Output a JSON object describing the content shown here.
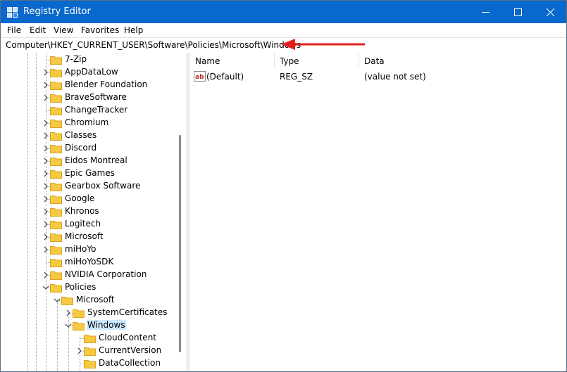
{
  "window": {
    "title": "Registry Editor"
  },
  "titlebar_buttons": {
    "minimize": "—",
    "maximize": "☐",
    "close": "✕"
  },
  "menu": [
    "File",
    "Edit",
    "View",
    "Favorites",
    "Help"
  ],
  "address": "Computer\\HKEY_CURRENT_USER\\Software\\Policies\\Microsoft\\Windows",
  "tree": [
    {
      "label": "7-Zip",
      "expander": "none"
    },
    {
      "label": "AppDataLow",
      "expander": "collapsed"
    },
    {
      "label": "Blender Foundation",
      "expander": "collapsed"
    },
    {
      "label": "BraveSoftware",
      "expander": "collapsed"
    },
    {
      "label": "ChangeTracker",
      "expander": "none"
    },
    {
      "label": "Chromium",
      "expander": "collapsed"
    },
    {
      "label": "Classes",
      "expander": "collapsed"
    },
    {
      "label": "Discord",
      "expander": "collapsed"
    },
    {
      "label": "Eidos Montreal",
      "expander": "collapsed"
    },
    {
      "label": "Epic Games",
      "expander": "collapsed"
    },
    {
      "label": "Gearbox Software",
      "expander": "collapsed"
    },
    {
      "label": "Google",
      "expander": "collapsed"
    },
    {
      "label": "Khronos",
      "expander": "collapsed"
    },
    {
      "label": "Logitech",
      "expander": "collapsed"
    },
    {
      "label": "Microsoft",
      "expander": "collapsed"
    },
    {
      "label": "miHoYo",
      "expander": "collapsed"
    },
    {
      "label": "miHoYoSDK",
      "expander": "none"
    },
    {
      "label": "NVIDIA Corporation",
      "expander": "collapsed"
    },
    {
      "label": "Policies",
      "expander": "expanded"
    },
    {
      "label": "Microsoft",
      "expander": "expanded"
    },
    {
      "label": "SystemCertificates",
      "expander": "collapsed"
    },
    {
      "label": "Windows",
      "expander": "expanded",
      "selected": true
    },
    {
      "label": "CloudContent",
      "expander": "none"
    },
    {
      "label": "CurrentVersion",
      "expander": "collapsed"
    },
    {
      "label": "DataCollection",
      "expander": "none"
    }
  ],
  "columns": {
    "name": "Name",
    "type": "Type",
    "data": "Data"
  },
  "values": [
    {
      "icon": "string-value-icon",
      "icon_text": "ab",
      "name": "(Default)",
      "type": "REG_SZ",
      "data": "(value not set)"
    }
  ],
  "colors": {
    "titlebar": "#0868cc",
    "folder": "#f6c944",
    "arrow": "#e02020",
    "selection": "#cce8ff"
  }
}
